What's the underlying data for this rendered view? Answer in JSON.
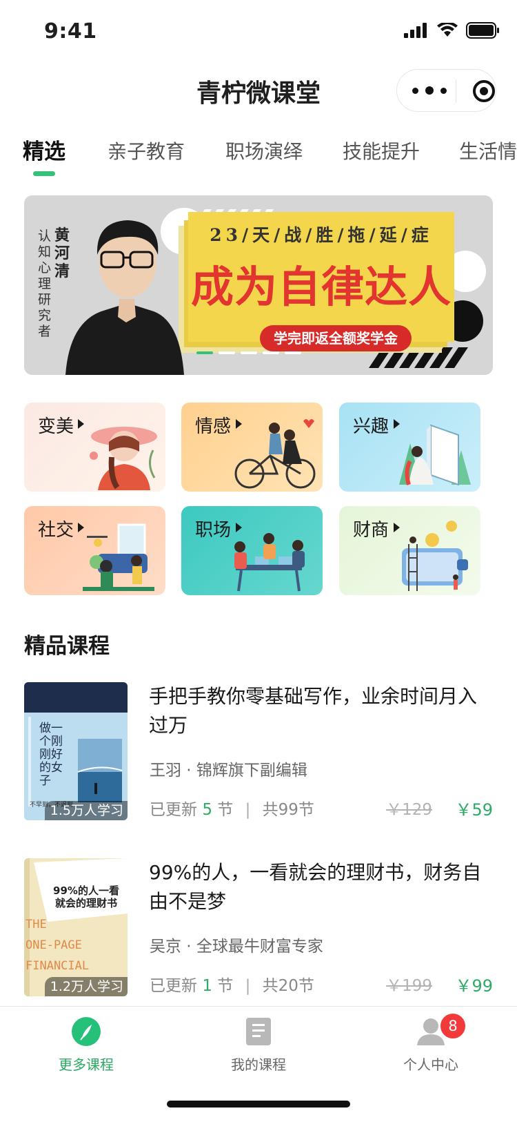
{
  "status_bar": {
    "time": "9:41"
  },
  "nav": {
    "title": "青柠微课堂"
  },
  "tabs": [
    "精选",
    "亲子教育",
    "职场演绎",
    "技能提升",
    "生活情趣"
  ],
  "banner": {
    "person_name": "黄河清",
    "person_title": "认知心理研究者",
    "subtitle": "23/天/战/胜/拖/延/症",
    "headline": "成为自律达人",
    "pill": "学完即返全额奖学金",
    "page_count": 5,
    "current_page": 1
  },
  "categories": [
    {
      "label": "变美"
    },
    {
      "label": "情感"
    },
    {
      "label": "兴趣"
    },
    {
      "label": "社交"
    },
    {
      "label": "职场"
    },
    {
      "label": "财商"
    }
  ],
  "section": {
    "title": "精品课程"
  },
  "courses": [
    {
      "title": "手把手教你零基础写作，业余时间月入过万",
      "author": "王羽 · 锦辉旗下副编辑",
      "updated_prefix": "已更新",
      "updated_count": "5",
      "updated_suffix": "节",
      "total": "共99节",
      "old_price": "￥129",
      "new_price": "￥59",
      "learners": "1.5万人学习",
      "cover_title": "做一个刚刚好的女子",
      "cover_footer": "不早到，不迟到"
    },
    {
      "title": "99%的人，一看就会的理财书，财务自由不是梦",
      "author": "吴京 · 全球最牛财富专家",
      "updated_prefix": "已更新",
      "updated_count": "1",
      "updated_suffix": "节",
      "total": "共20节",
      "old_price": "￥199",
      "new_price": "￥99",
      "learners": "1.2万人学习",
      "cover_title": "99%的人一看就会的理财书",
      "cover_en": [
        "THE",
        "ONE-PAGE",
        "FINANCIAL"
      ]
    }
  ],
  "tabbar": {
    "items": [
      {
        "label": "更多课程",
        "icon": "compass-icon"
      },
      {
        "label": "我的课程",
        "icon": "document-icon"
      },
      {
        "label": "个人中心",
        "icon": "user-icon",
        "badge": "8"
      }
    ]
  },
  "colors": {
    "accent": "#34c17a",
    "price": "#2eaa66",
    "badge": "#f23a3a",
    "banner_red": "#e2352f",
    "banner_yellow": "#f4d64c"
  }
}
